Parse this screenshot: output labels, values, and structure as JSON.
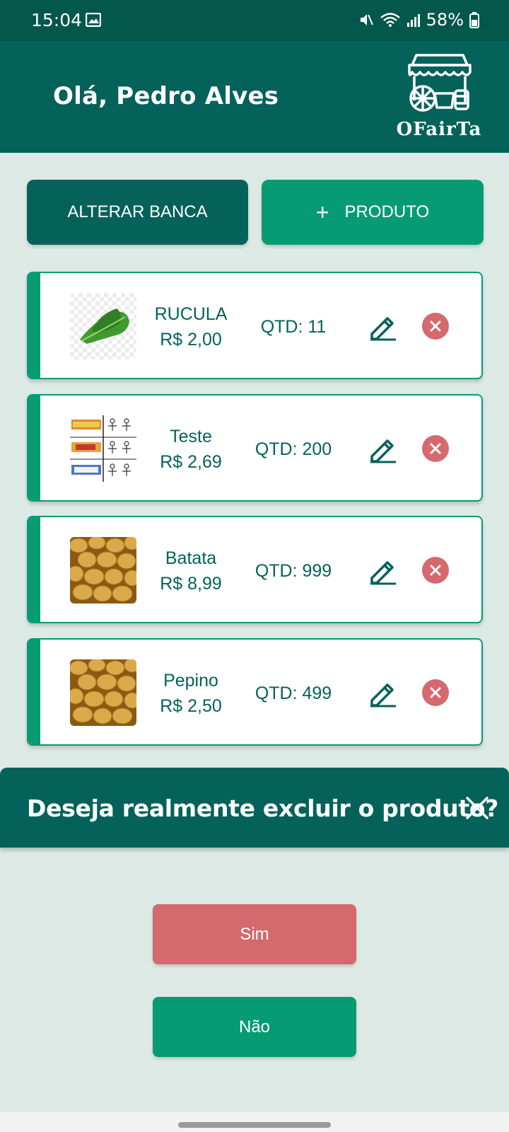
{
  "status_bar": {
    "time": "15:04",
    "battery": "58%",
    "icons": [
      "gallery-icon",
      "mute-icon",
      "wifi-icon",
      "signal-icon",
      "battery-icon"
    ]
  },
  "header": {
    "greeting": "Olá, Pedro Alves",
    "logo_text": "OFairTa"
  },
  "actions": {
    "alterar_label": "ALTERAR BANCA",
    "produto_plus": "+",
    "produto_label": "PRODUTO"
  },
  "products": [
    {
      "name": "RUCULA",
      "price": "R$ 2,00",
      "qty": "QTD: 11",
      "image": "arugula-image"
    },
    {
      "name": "Teste",
      "price": "R$ 2,69",
      "qty": "QTD: 200",
      "image": "manga-collage-image"
    },
    {
      "name": "Batata",
      "price": "R$ 8,99",
      "qty": "QTD: 999",
      "image": "potatoes-image"
    },
    {
      "name": "Pepino",
      "price": "R$ 2,50",
      "qty": "QTD: 499",
      "image": "potatoes-image"
    }
  ],
  "dialog": {
    "title": "Deseja realmente excluir o produto?",
    "confirm_label": "Sim",
    "cancel_label": "Não"
  },
  "colors": {
    "primary_dark": "#05625a",
    "status_bar": "#03574b",
    "primary": "#079b73",
    "danger": "#d4696e",
    "background": "#dde9e5"
  }
}
